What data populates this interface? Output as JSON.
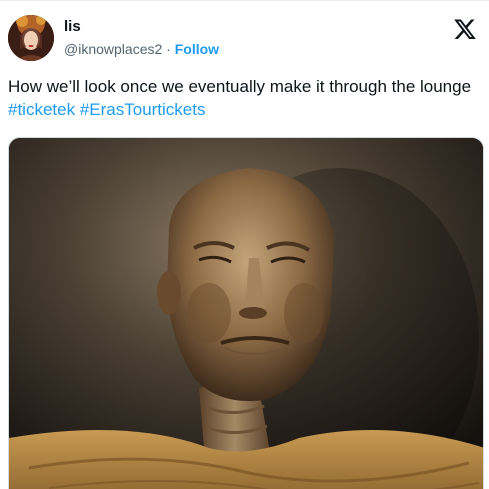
{
  "author": {
    "display_name": "lis",
    "handle": "@iknowplaces2",
    "separator": "·",
    "follow_label": "Follow"
  },
  "tweet": {
    "text_prefix": "How we’ll look once we eventually make it through the lounge",
    "hashtags": [
      "#ticketek",
      "#ErasTourtickets"
    ]
  },
  "icons": {
    "platform": "x-logo-icon",
    "avatar": "avatar-image"
  },
  "colors": {
    "link": "#1d9bf0",
    "text": "#0f1419",
    "muted": "#536471"
  }
}
